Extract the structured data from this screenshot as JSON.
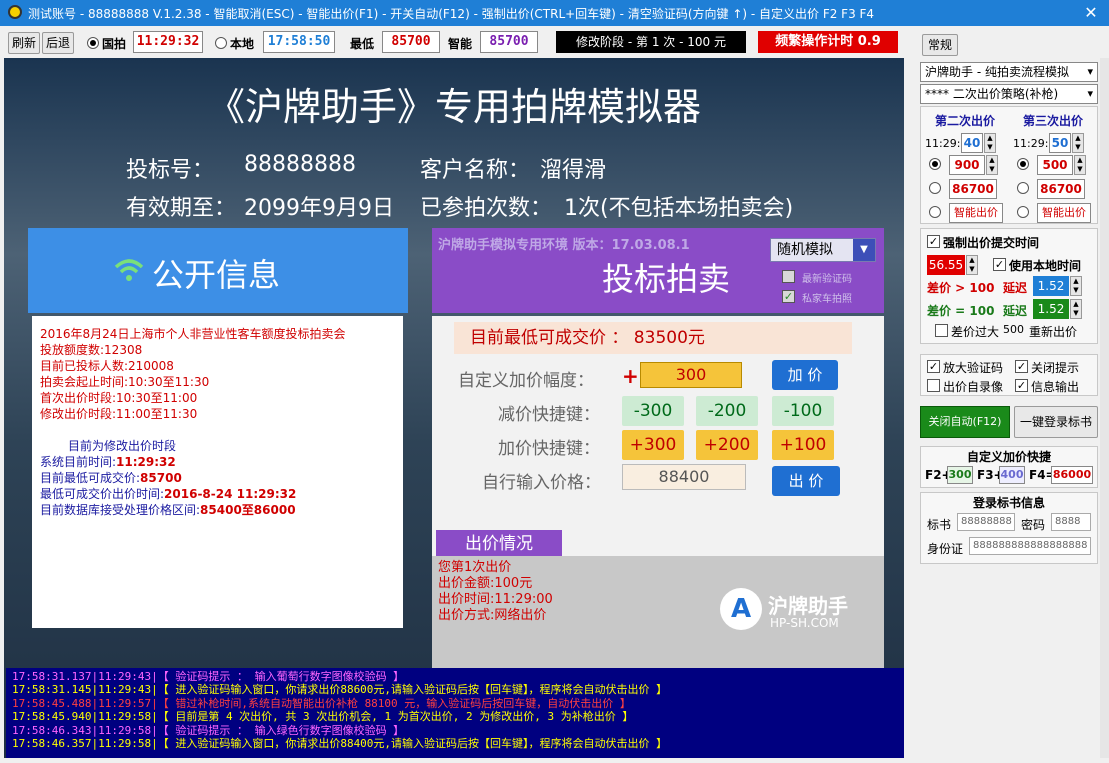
{
  "window": {
    "title": "测试账号 - 88888888 V.1.2.38 - 智能取消(ESC) - 智能出价(F1) - 开关自动(F12) - 强制出价(CTRL+回车键) - 清空验证码(方向键 ↑) - 自定义出价 F2 F3 F4",
    "close_glyph": "✕"
  },
  "toolbar": {
    "refresh_label": "刷新",
    "back_label": "后退",
    "national_label": "国拍",
    "national_time": "11:29:32",
    "local_label": "本地",
    "local_time": "17:58:50",
    "lowest_label": "最低",
    "lowest_value": "85700",
    "smart_label": "智能",
    "smart_value": "85700",
    "phase_text": "修改阶段 - 第 1 次 - 100 元",
    "frequent_text": "频繁操作计时 0.9",
    "normal_label": "常规"
  },
  "main": {
    "title": "《沪牌助手》专用拍牌模拟器",
    "bid_no_label": "投标号：",
    "bid_no": "88888888",
    "customer_label": "客户名称：",
    "customer": "溜得滑",
    "valid_label": "有效期至：",
    "valid": "2099年9月9日",
    "count_label": "已参拍次数：",
    "count": "1次(不包括本场拍卖会)"
  },
  "public_info": {
    "title": "公开信息",
    "lines_red": [
      "2016年8月24日上海市个人非营业性客车额度投标拍卖会",
      "投放额度数:12308",
      "目前已投标人数:210008",
      "拍卖会起止时间:10:30至11:30",
      "首次出价时段:10:30至11:00",
      "修改出价时段:11:00至11:30"
    ],
    "phase_line": "目前为修改出价时段",
    "sys_time_label": "系统目前时间:",
    "sys_time": "11:29:32",
    "min_price_label": "目前最低可成交价:",
    "min_price": "85700",
    "min_time_label": "最低可成交价出价时间:",
    "min_time": "2016-8-24 11:29:32",
    "range_label": "目前数据库接受处理价格区间:",
    "range": "85400至86000"
  },
  "bidding": {
    "env_text": "沪牌助手模拟专用环境 版本：17.03.08.1",
    "title": "投标拍卖",
    "mode_select": "随机模拟",
    "opt_captcha": "最新验证码",
    "opt_private": "私家车拍照",
    "min_price_text": "目前最低可成交价 ： 83500元",
    "custom_label": "自定义加价幅度：",
    "plus_sign": "+",
    "custom_value": "300",
    "add_label": "加 价",
    "minus_label": "减价快捷键：",
    "minus": [
      "-300",
      "-200",
      "-100"
    ],
    "plus_label": "加价快捷键：",
    "plus": [
      "+300",
      "+200",
      "+100"
    ],
    "input_label": "自行输入价格：",
    "input_value": "88400",
    "bid_label": "出 价",
    "status_title": "出价情况",
    "status_lines": [
      "您第1次出价",
      "出价金额:100元",
      "出价时间:11:29:00",
      "出价方式:网络出价"
    ],
    "logo_text": "沪牌助手",
    "logo_url": "HP-SH.COM"
  },
  "log": [
    {
      "text": "17:58:31.137|11:29:43|【 验证码提示 ： 输入葡萄行数字图像校验码 】",
      "color": "#ff66ff"
    },
    {
      "text": "17:58:31.145|11:29:43|【 进入验证码输入窗口，你请求出价88600元,请输入验证码后按【回车键】，程序将会自动伏击出价 】",
      "color": "#ffff00"
    },
    {
      "text": "17:58:45.488|11:29:57|【 错过补枪时间,系统自动智能出价补枪 88100 元，输入验证码后按回车键，自动伏击出价 】",
      "color": "#ff4040"
    },
    {
      "text": "17:58:45.940|11:29:58|【 目前是第 4 次出价, 共 3 次出价机会, 1 为首次出价, 2 为修改出价, 3 为补枪出价 】",
      "color": "#ffff00"
    },
    {
      "text": "17:58:46.343|11:29:58|【 验证码提示 ： 输入绿色行数字图像校验码 】",
      "color": "#ff66ff"
    },
    {
      "text": "17:58:46.357|11:29:58|【 进入验证码输入窗口，你请求出价88400元,请输入验证码后按【回车键】，程序将会自动伏击出价 】",
      "color": "#ffff00"
    }
  ],
  "side": {
    "mode_select": "沪牌助手 - 纯拍卖流程模拟",
    "strategy_select": "**** 二次出价策略(补枪)",
    "second_title": "第二次出价",
    "third_title": "第三次出价",
    "time_prefix": "11:29:",
    "second_sec": "40",
    "third_sec": "50",
    "second_price": "900",
    "third_price": "500",
    "second_fixed": "86700",
    "third_fixed": "86700",
    "smart_bid": "智能出价",
    "force_label": "强制出价提交时间",
    "force_value": "56.55",
    "local_time_label": "使用本地时间",
    "diff_gt": "差价 > 100",
    "delay_label": "延迟",
    "delay1": "1.52",
    "diff_eq": "差价 = 100",
    "delay2": "1.52",
    "diff_big_label": "差价过大",
    "diff_big_val": "500",
    "rebid_label": "重新出价",
    "enlarge_captcha": "放大验证码",
    "close_tips": "关闭提示",
    "record_label": "出价自录像",
    "info_output": "信息输出",
    "auto_close": "关闭自动(F12)",
    "login_btn": "一键登录标书",
    "custom_title": "自定义加价快捷",
    "f2": "F2+",
    "f2v": "300",
    "f3": "F3+",
    "f3v": "400",
    "f4": "F4=",
    "f4v": "86000",
    "login_title": "登录标书信息",
    "book_label": "标书",
    "book_value": "88888888",
    "pwd_label": "密码",
    "pwd_value": "8888",
    "id_label": "身份证",
    "id_value": "888888888888888888"
  },
  "colors": {
    "titlebar": "#1f7fd6",
    "public": "#3d8fe6",
    "bidding": "#8a4cc7",
    "log_bg": "#000080",
    "accent_red": "#d00000"
  }
}
